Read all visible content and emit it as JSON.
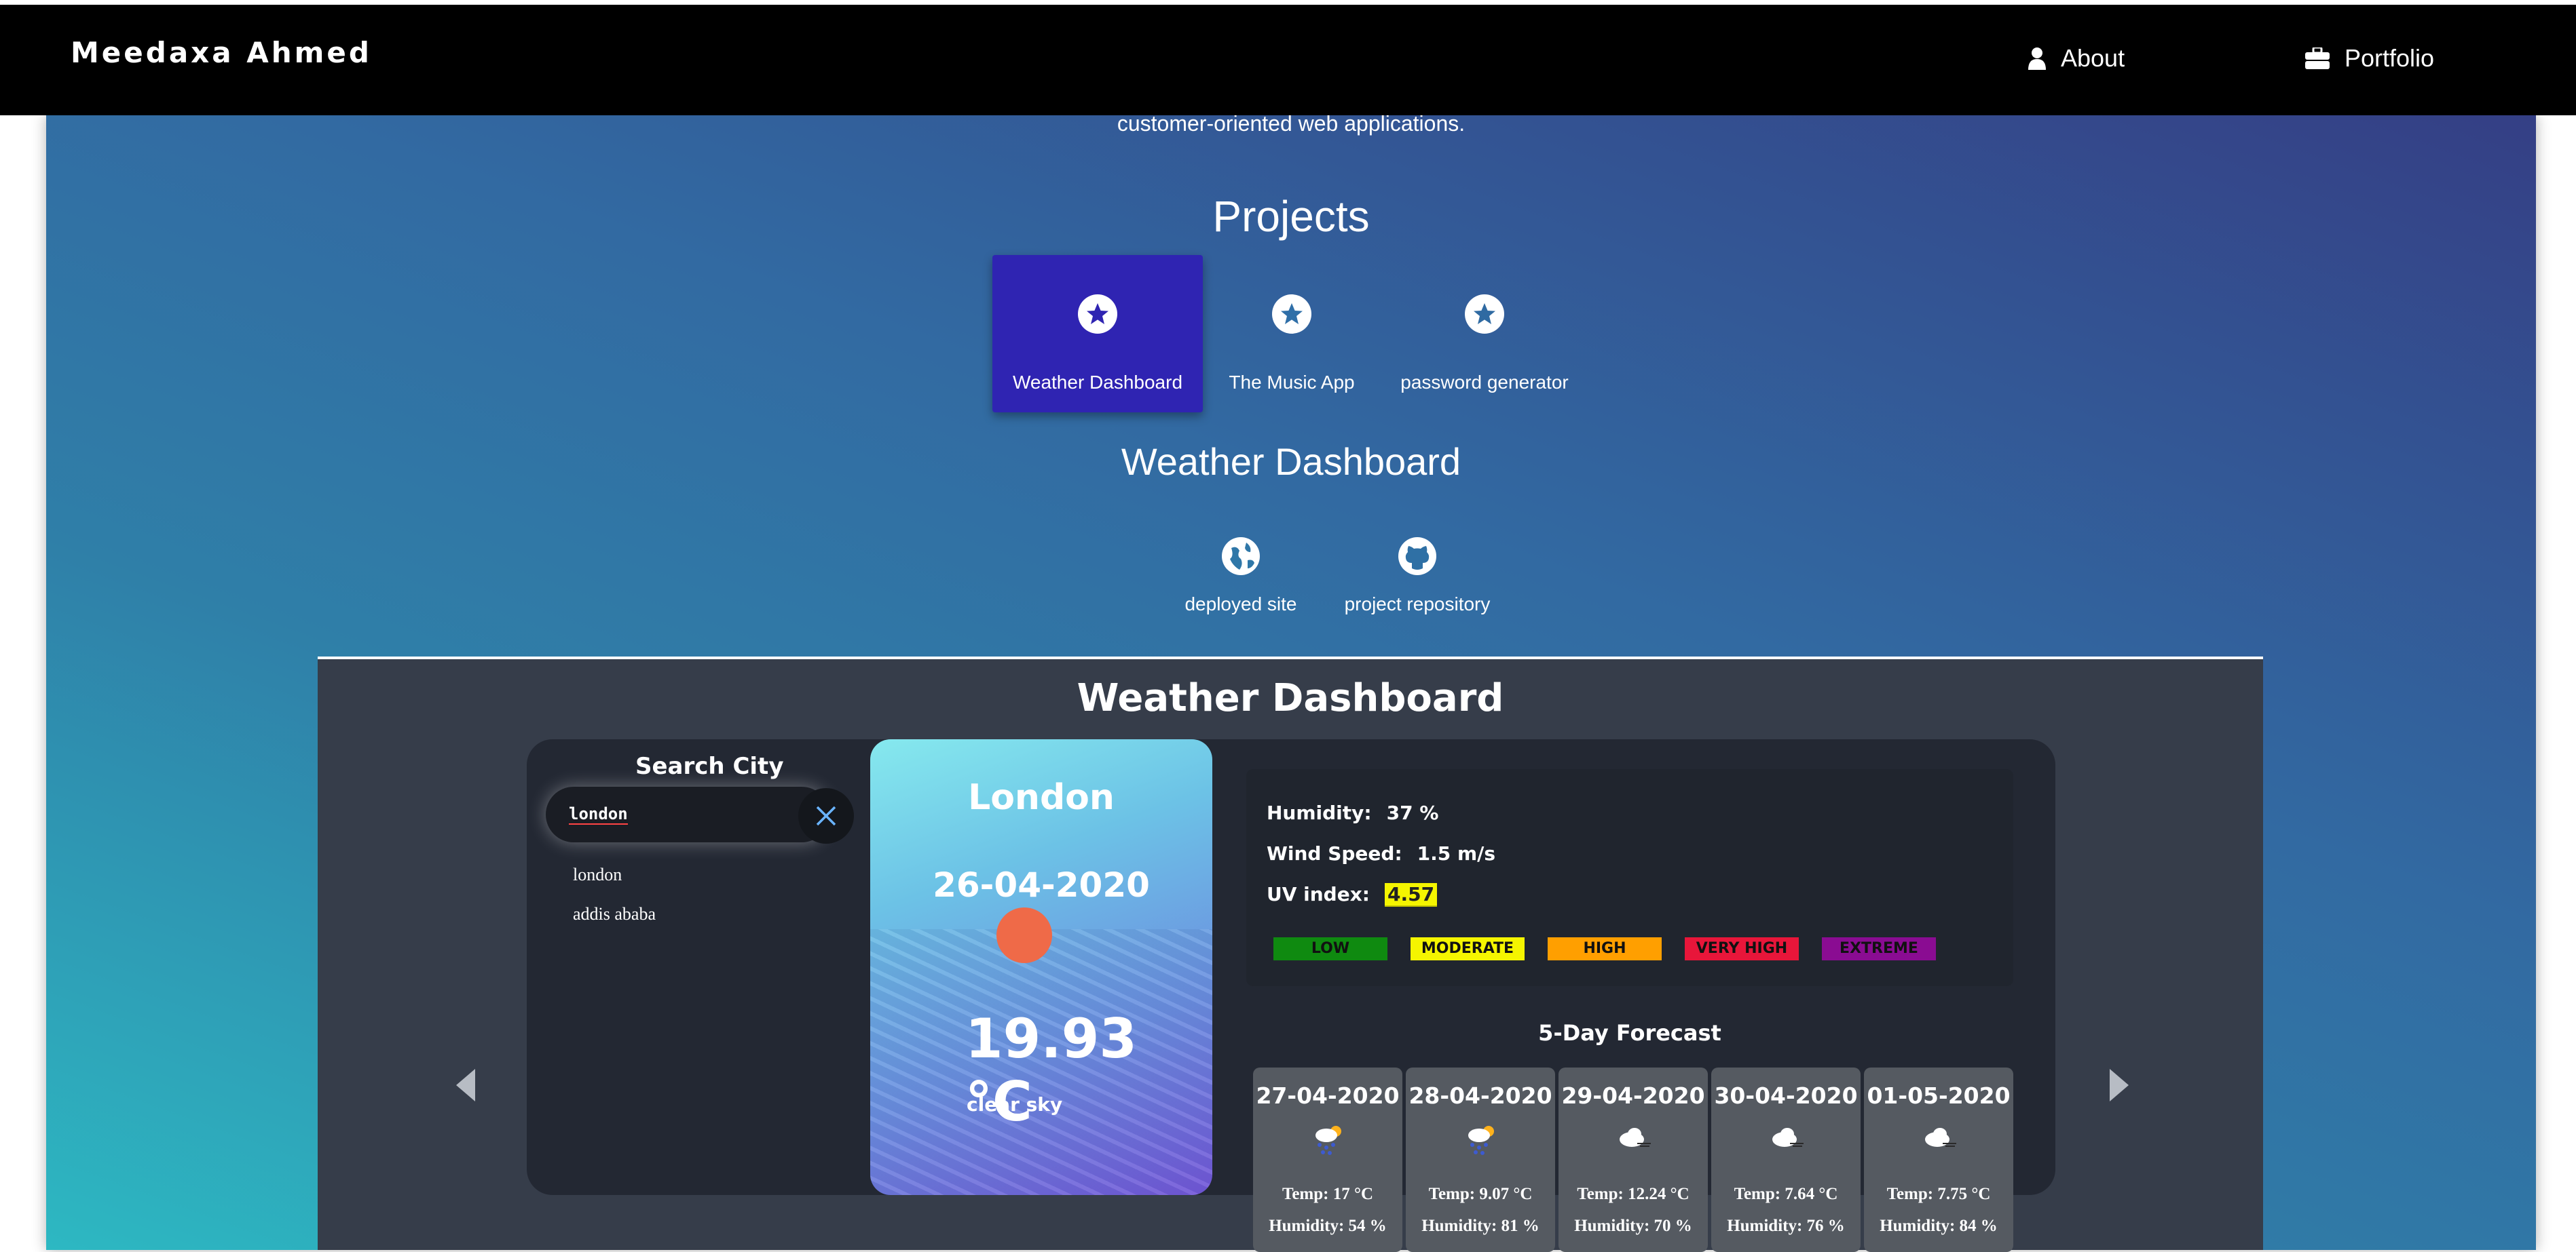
{
  "navbar": {
    "brand": "Meedaxa Ahmed",
    "about_label": "About",
    "portfolio_label": "Portfolio",
    "about_icon": "user-icon",
    "portfolio_icon": "briefcase-icon"
  },
  "intro": {
    "tail_text": "customer-oriented web applications."
  },
  "projects": {
    "title": "Projects",
    "items": [
      {
        "label": "Weather Dashboard",
        "icon": "star-icon",
        "active": true
      },
      {
        "label": "The Music App",
        "icon": "star-icon",
        "active": false
      },
      {
        "label": "password generator",
        "icon": "star-icon",
        "active": false
      }
    ]
  },
  "project_detail": {
    "title": "Weather Dashboard",
    "links": [
      {
        "label": "deployed site",
        "icon": "globe-icon"
      },
      {
        "label": "project repository",
        "icon": "github-icon"
      }
    ]
  },
  "dashboard": {
    "title": "Weather Dashboard",
    "search": {
      "title": "Search City",
      "value": "london",
      "suggestions": [
        "london",
        "addis ababa"
      ]
    },
    "current": {
      "city": "London",
      "date": "26-04-2020",
      "temp": "19.93 °C",
      "description": "clear sky"
    },
    "stats": {
      "humidity_label": "Humidity:",
      "humidity_value": "37 %",
      "wind_label": "Wind Speed:",
      "wind_value": "1.5 m/s",
      "uv_label": "UV index:",
      "uv_value": "4.57"
    },
    "uv_scale": [
      {
        "label": "LOW",
        "color": "#0f8a10"
      },
      {
        "label": "MODERATE",
        "color": "#f5f500"
      },
      {
        "label": "HIGH",
        "color": "#ff9f00"
      },
      {
        "label": "VERY HIGH",
        "color": "#e8163a"
      },
      {
        "label": "EXTREME",
        "color": "#8a0c92"
      }
    ],
    "forecast": {
      "title": "5-Day Forecast",
      "days": [
        {
          "date": "27-04-2020",
          "icon": "rain-sun-icon",
          "temp": "Temp: 17 °C",
          "humidity": "Humidity: 54 %"
        },
        {
          "date": "28-04-2020",
          "icon": "rain-sun-icon",
          "temp": "Temp: 9.07 °C",
          "humidity": "Humidity: 81 %"
        },
        {
          "date": "29-04-2020",
          "icon": "cloud-wind-icon",
          "temp": "Temp: 12.24 °C",
          "humidity": "Humidity: 70 %"
        },
        {
          "date": "30-04-2020",
          "icon": "cloud-wind-icon",
          "temp": "Temp: 7.64 °C",
          "humidity": "Humidity: 76 %"
        },
        {
          "date": "01-05-2020",
          "icon": "cloud-wind-icon",
          "temp": "Temp: 7.75 °C",
          "humidity": "Humidity: 84 %"
        }
      ]
    }
  }
}
